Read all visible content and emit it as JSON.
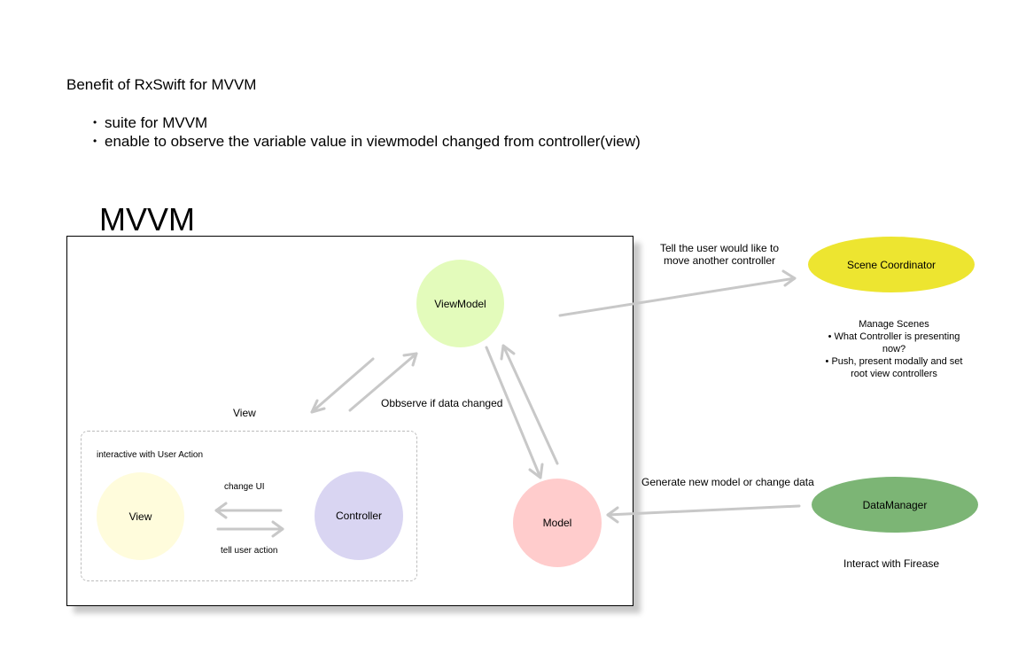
{
  "heading": "Benefit of RxSwift for MVVM",
  "bullets": [
    "suite for MVVM",
    "enable to observe the variable value in viewmodel changed from controller(view)"
  ],
  "diagram_title": "MVVM",
  "nodes": {
    "viewmodel": {
      "label": "ViewModel",
      "color": "#e3fbbb"
    },
    "view": {
      "label": "View",
      "color": "#fffcdc"
    },
    "controller": {
      "label": "Controller",
      "color": "#d9d5f2"
    },
    "model": {
      "label": "Model",
      "color": "#ffcccc"
    },
    "scene_coordinator": {
      "label": "Scene Coordinator",
      "color": "#ede530"
    },
    "data_manager": {
      "label": "DataManager",
      "color": "#7cb575"
    }
  },
  "labels": {
    "view_group": "View",
    "interactive": "interactive with User Action",
    "change_ui": "change UI",
    "tell_user_action": "tell user action",
    "observe": "Obbserve if data changed",
    "tell_user": [
      "Tell the user would like to",
      "move another controller"
    ],
    "generate": "Generate new model or change data",
    "interact": "Interact with Firease"
  },
  "scene_notes": {
    "title": "Manage Scenes",
    "items": [
      [
        "What Controller is presenting",
        "now?"
      ],
      [
        "Push, present modally and set",
        "root view controllers"
      ]
    ]
  },
  "colors": {
    "arrow": "#c8c8c8",
    "frame_border": "#000000",
    "group_border": "#bdbdbd"
  }
}
